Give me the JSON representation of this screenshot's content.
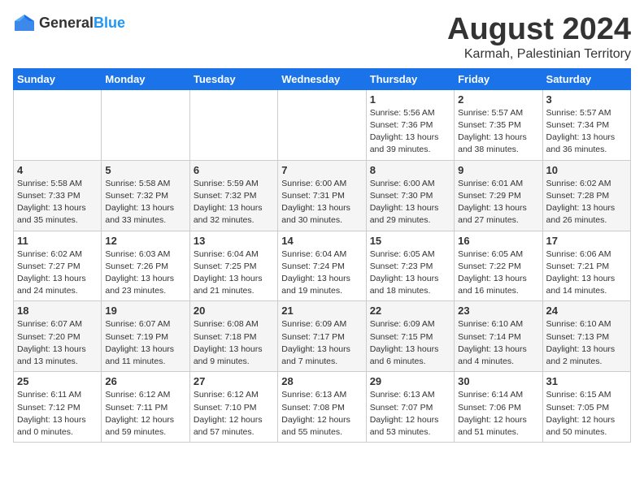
{
  "header": {
    "logo_general": "General",
    "logo_blue": "Blue",
    "month_year": "August 2024",
    "location": "Karmah, Palestinian Territory"
  },
  "weekdays": [
    "Sunday",
    "Monday",
    "Tuesday",
    "Wednesday",
    "Thursday",
    "Friday",
    "Saturday"
  ],
  "weeks": [
    [
      {
        "day": "",
        "info": ""
      },
      {
        "day": "",
        "info": ""
      },
      {
        "day": "",
        "info": ""
      },
      {
        "day": "",
        "info": ""
      },
      {
        "day": "1",
        "info": "Sunrise: 5:56 AM\nSunset: 7:36 PM\nDaylight: 13 hours\nand 39 minutes."
      },
      {
        "day": "2",
        "info": "Sunrise: 5:57 AM\nSunset: 7:35 PM\nDaylight: 13 hours\nand 38 minutes."
      },
      {
        "day": "3",
        "info": "Sunrise: 5:57 AM\nSunset: 7:34 PM\nDaylight: 13 hours\nand 36 minutes."
      }
    ],
    [
      {
        "day": "4",
        "info": "Sunrise: 5:58 AM\nSunset: 7:33 PM\nDaylight: 13 hours\nand 35 minutes."
      },
      {
        "day": "5",
        "info": "Sunrise: 5:58 AM\nSunset: 7:32 PM\nDaylight: 13 hours\nand 33 minutes."
      },
      {
        "day": "6",
        "info": "Sunrise: 5:59 AM\nSunset: 7:32 PM\nDaylight: 13 hours\nand 32 minutes."
      },
      {
        "day": "7",
        "info": "Sunrise: 6:00 AM\nSunset: 7:31 PM\nDaylight: 13 hours\nand 30 minutes."
      },
      {
        "day": "8",
        "info": "Sunrise: 6:00 AM\nSunset: 7:30 PM\nDaylight: 13 hours\nand 29 minutes."
      },
      {
        "day": "9",
        "info": "Sunrise: 6:01 AM\nSunset: 7:29 PM\nDaylight: 13 hours\nand 27 minutes."
      },
      {
        "day": "10",
        "info": "Sunrise: 6:02 AM\nSunset: 7:28 PM\nDaylight: 13 hours\nand 26 minutes."
      }
    ],
    [
      {
        "day": "11",
        "info": "Sunrise: 6:02 AM\nSunset: 7:27 PM\nDaylight: 13 hours\nand 24 minutes."
      },
      {
        "day": "12",
        "info": "Sunrise: 6:03 AM\nSunset: 7:26 PM\nDaylight: 13 hours\nand 23 minutes."
      },
      {
        "day": "13",
        "info": "Sunrise: 6:04 AM\nSunset: 7:25 PM\nDaylight: 13 hours\nand 21 minutes."
      },
      {
        "day": "14",
        "info": "Sunrise: 6:04 AM\nSunset: 7:24 PM\nDaylight: 13 hours\nand 19 minutes."
      },
      {
        "day": "15",
        "info": "Sunrise: 6:05 AM\nSunset: 7:23 PM\nDaylight: 13 hours\nand 18 minutes."
      },
      {
        "day": "16",
        "info": "Sunrise: 6:05 AM\nSunset: 7:22 PM\nDaylight: 13 hours\nand 16 minutes."
      },
      {
        "day": "17",
        "info": "Sunrise: 6:06 AM\nSunset: 7:21 PM\nDaylight: 13 hours\nand 14 minutes."
      }
    ],
    [
      {
        "day": "18",
        "info": "Sunrise: 6:07 AM\nSunset: 7:20 PM\nDaylight: 13 hours\nand 13 minutes."
      },
      {
        "day": "19",
        "info": "Sunrise: 6:07 AM\nSunset: 7:19 PM\nDaylight: 13 hours\nand 11 minutes."
      },
      {
        "day": "20",
        "info": "Sunrise: 6:08 AM\nSunset: 7:18 PM\nDaylight: 13 hours\nand 9 minutes."
      },
      {
        "day": "21",
        "info": "Sunrise: 6:09 AM\nSunset: 7:17 PM\nDaylight: 13 hours\nand 7 minutes."
      },
      {
        "day": "22",
        "info": "Sunrise: 6:09 AM\nSunset: 7:15 PM\nDaylight: 13 hours\nand 6 minutes."
      },
      {
        "day": "23",
        "info": "Sunrise: 6:10 AM\nSunset: 7:14 PM\nDaylight: 13 hours\nand 4 minutes."
      },
      {
        "day": "24",
        "info": "Sunrise: 6:10 AM\nSunset: 7:13 PM\nDaylight: 13 hours\nand 2 minutes."
      }
    ],
    [
      {
        "day": "25",
        "info": "Sunrise: 6:11 AM\nSunset: 7:12 PM\nDaylight: 13 hours\nand 0 minutes."
      },
      {
        "day": "26",
        "info": "Sunrise: 6:12 AM\nSunset: 7:11 PM\nDaylight: 12 hours\nand 59 minutes."
      },
      {
        "day": "27",
        "info": "Sunrise: 6:12 AM\nSunset: 7:10 PM\nDaylight: 12 hours\nand 57 minutes."
      },
      {
        "day": "28",
        "info": "Sunrise: 6:13 AM\nSunset: 7:08 PM\nDaylight: 12 hours\nand 55 minutes."
      },
      {
        "day": "29",
        "info": "Sunrise: 6:13 AM\nSunset: 7:07 PM\nDaylight: 12 hours\nand 53 minutes."
      },
      {
        "day": "30",
        "info": "Sunrise: 6:14 AM\nSunset: 7:06 PM\nDaylight: 12 hours\nand 51 minutes."
      },
      {
        "day": "31",
        "info": "Sunrise: 6:15 AM\nSunset: 7:05 PM\nDaylight: 12 hours\nand 50 minutes."
      }
    ]
  ]
}
